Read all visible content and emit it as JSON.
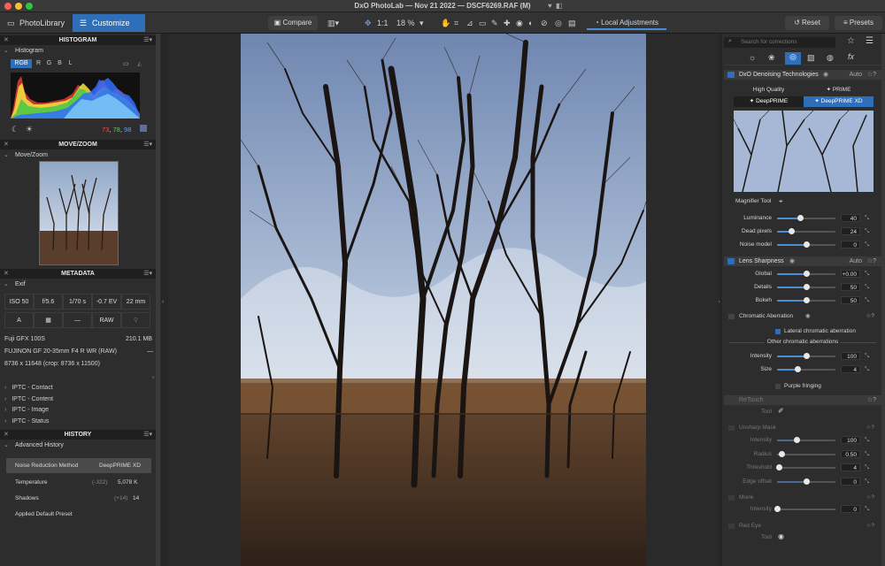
{
  "window": {
    "title": "DxO PhotoLab — Nov 21 2022 — DSCF6269.RAF (M)"
  },
  "toolbar": {
    "tabs": [
      {
        "label": "PhotoLibrary",
        "icon": "photo-library-icon"
      },
      {
        "label": "Customize",
        "icon": "sliders-icon",
        "active": true
      }
    ],
    "compare_label": "Compare",
    "zoom_1to1": "1:1",
    "zoom_value": "18 %",
    "local_adjustments_label": "Local Adjustments",
    "reset_label": "Reset",
    "presets_label": "Presets"
  },
  "left": {
    "histogram": {
      "title": "HISTOGRAM",
      "subtitle": "Histogram",
      "channels": [
        "RGB",
        "R",
        "G",
        "B",
        "L"
      ],
      "active_channel": "RGB",
      "readout": {
        "r": "73",
        "g": "78",
        "b": "98"
      }
    },
    "movezoom": {
      "title": "MOVE/ZOOM",
      "subtitle": "Move/Zoom"
    },
    "metadata": {
      "title": "METADATA",
      "subtitle": "Exif",
      "exif": [
        "ISO 50",
        "f/5.6",
        "1/70 s",
        "-0.7 EV",
        "22 mm"
      ],
      "exif_row2": [
        "A",
        "",
        "—",
        "RAW",
        ""
      ],
      "camera": "Fuji GFX 100S",
      "file_size": "210.1 MB",
      "lens": "FUJINON GF 20-35mm F4 R WR (RAW)",
      "lens_extra": "—",
      "dimensions": "8736 x 11648  (crop: 8736 x 11500)",
      "iptc": [
        "IPTC - Contact",
        "IPTC - Content",
        "IPTC - Image",
        "IPTC - Status"
      ]
    },
    "history": {
      "title": "HISTORY",
      "subtitle": "Advanced History",
      "items": [
        {
          "key": "Noise Reduction Method",
          "delta": "",
          "value": "DeepPRIME XD"
        },
        {
          "key": "Temperature",
          "delta": "(-322)",
          "value": "5,078 K"
        },
        {
          "key": "Shadows",
          "delta": "(+14)",
          "value": "14"
        },
        {
          "key": "Applied Default Preset",
          "delta": "",
          "value": ""
        }
      ]
    }
  },
  "right": {
    "search_placeholder": "Search for corrections",
    "denoise": {
      "title": "DxO Denoising Technologies",
      "auto": "Auto",
      "modes": [
        "High Quality",
        "PRIME",
        "DeepPRIME",
        "DeepPRIME XD"
      ],
      "active_mode": "DeepPRIME XD",
      "magnifier_label": "Magnifier Tool",
      "sliders": [
        {
          "label": "Luminance",
          "value": "40",
          "level": 0.4
        },
        {
          "label": "Dead pixels",
          "value": "24",
          "level": 0.24
        },
        {
          "label": "Noise model",
          "value": "0",
          "level": 0.5
        }
      ]
    },
    "sharpness": {
      "title": "Lens Sharpness",
      "auto": "Auto",
      "sliders": [
        {
          "label": "Global",
          "value": "+0.00",
          "level": 0.5
        },
        {
          "label": "Details",
          "value": "50",
          "level": 0.5
        },
        {
          "label": "Bokeh",
          "value": "50",
          "level": 0.5
        }
      ]
    },
    "chromatic": {
      "title": "Chromatic Aberration",
      "lateral_label": "Lateral chromatic aberration",
      "other_label": "Other chromatic aberrations",
      "sliders": [
        {
          "label": "Intensity",
          "value": "100",
          "level": 0.5
        },
        {
          "label": "Size",
          "value": "4",
          "level": 0.35
        }
      ],
      "purple_label": "Purple fringing"
    },
    "retouch": {
      "title": "ReTouch",
      "tool_label": "Tool"
    },
    "unsharp": {
      "title": "Unsharp Mask",
      "sliders": [
        {
          "label": "Intensity",
          "value": "100",
          "level": 0.33
        },
        {
          "label": "Radius",
          "value": "0.50",
          "level": 0.07
        },
        {
          "label": "Threshold",
          "value": "4",
          "level": 0.03
        },
        {
          "label": "Edge offset",
          "value": "0",
          "level": 0.5
        }
      ]
    },
    "moire": {
      "title": "Moiré",
      "sliders": [
        {
          "label": "Intensity",
          "value": "0",
          "level": 0.0
        }
      ]
    },
    "redeye": {
      "title": "Red Eye",
      "tool_label": "Tool"
    }
  },
  "colors": {
    "accent": "#2f6fba",
    "panel": "#2d2d2d",
    "header": "#1f1f1f"
  }
}
